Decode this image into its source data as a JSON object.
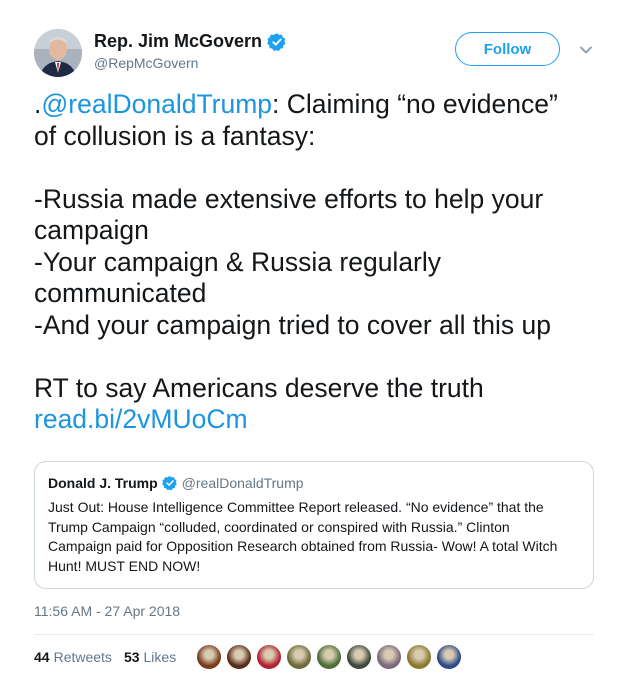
{
  "author": {
    "display_name": "Rep. Jim McGovern",
    "handle": "@RepMcGovern",
    "verified_icon": "verified-badge-icon"
  },
  "actions": {
    "follow_label": "Follow",
    "caret_icon": "chevron-down-icon"
  },
  "tweet": {
    "lines": [
      ".",
      "@realDonaldTrump",
      ": Claiming “no evidence”",
      "of collusion is a fantasy:",
      "-Russia made extensive efforts to help your",
      "campaign",
      "-Your campaign & Russia regularly",
      "communicated",
      "-And your campaign tried to cover all this up",
      "RT to say Americans deserve the truth",
      "read.bi/2vMUoCm"
    ]
  },
  "quoted": {
    "name": "Donald J. Trump",
    "handle": "@realDonaldTrump",
    "lines": [
      "Just Out: House Intelligence Committee Report released. “No evidence” that the",
      "Trump Campaign “colluded, coordinated or conspired with Russia.” Clinton",
      "Campaign paid for Opposition Research obtained from Russia- Wow! A total Witch",
      "Hunt! MUST END NOW!"
    ]
  },
  "meta": {
    "timestamp": "11:56 AM - 27 Apr 2018",
    "retweets_count": "44",
    "retweets_label": "Retweets",
    "likes_count": "53",
    "likes_label": "Likes"
  },
  "colors": {
    "accent": "#1da1f2",
    "link": "#1b95e0",
    "text": "#14171a",
    "secondary": "#657786",
    "border": "#ccd6dd"
  },
  "likers": [
    {
      "color": "#7a3b1e"
    },
    {
      "color": "#5a2e1a"
    },
    {
      "color": "#b22234"
    },
    {
      "color": "#6d6a3c"
    },
    {
      "color": "#4e6e3a"
    },
    {
      "color": "#3d4a3d"
    },
    {
      "color": "#7b6a7e"
    },
    {
      "color": "#8a7a2e"
    },
    {
      "color": "#2f4a8a"
    }
  ]
}
